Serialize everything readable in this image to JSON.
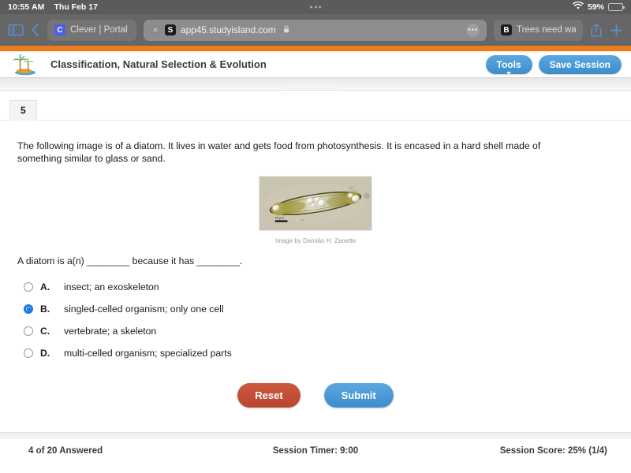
{
  "ios_status": {
    "time": "10:55 AM",
    "date": "Thu Feb 17",
    "battery_percent": "59%",
    "battery_level": 59,
    "wifi_icon": "wifi-icon",
    "battery_icon": "battery-icon",
    "battery_color": "#f5c518"
  },
  "safari": {
    "sidebar_icon": "sidebar-toggle-icon",
    "back_icon": "back-chevron-icon",
    "share_icon": "share-icon",
    "new_tab_icon": "plus-icon",
    "more_label": "•••",
    "tabs": [
      {
        "title": "Clever | Portal",
        "favicon_letter": "C",
        "active": false
      },
      {
        "title": "app45.studyisland.com",
        "favicon_letter": "S",
        "active": true,
        "lock_icon": "lock-icon",
        "close_icon": "close-icon"
      },
      {
        "title": "Trees need water",
        "favicon_letter": "B",
        "active": false
      }
    ]
  },
  "app_header": {
    "logo_icon": "palm-tree-island-logo",
    "title": "Classification, Natural Selection & Evolution",
    "tools_label": "Tools",
    "save_label": "Save Session",
    "accent_orange": "#ee7b1c",
    "accent_blue": "#3d8dcc"
  },
  "question": {
    "number": "5",
    "passage": "The following image is of a diatom. It lives in water and gets food from photosynthesis. It is encased in a hard shell made of something similar to glass or sand.",
    "image_caption": "Image by Damián H. Zanette",
    "image_alt": "diatom-microscope-photo",
    "scale_bar_label": "10 µm",
    "stem": "A diatom is a(n) ________ because it has ________.",
    "choices": [
      {
        "letter": "A.",
        "text": "insect; an exoskeleton",
        "selected": false
      },
      {
        "letter": "B.",
        "text": "singled-celled organism; only one cell",
        "selected": true
      },
      {
        "letter": "C.",
        "text": "vertebrate; a skeleton",
        "selected": false
      },
      {
        "letter": "D.",
        "text": "multi-celled organism; specialized parts",
        "selected": false
      }
    ],
    "reset_label": "Reset",
    "submit_label": "Submit"
  },
  "footer": {
    "answered": "4 of 20 Answered",
    "timer": "Session Timer: 9:00",
    "score": "Session Score: 25% (1/4)"
  }
}
